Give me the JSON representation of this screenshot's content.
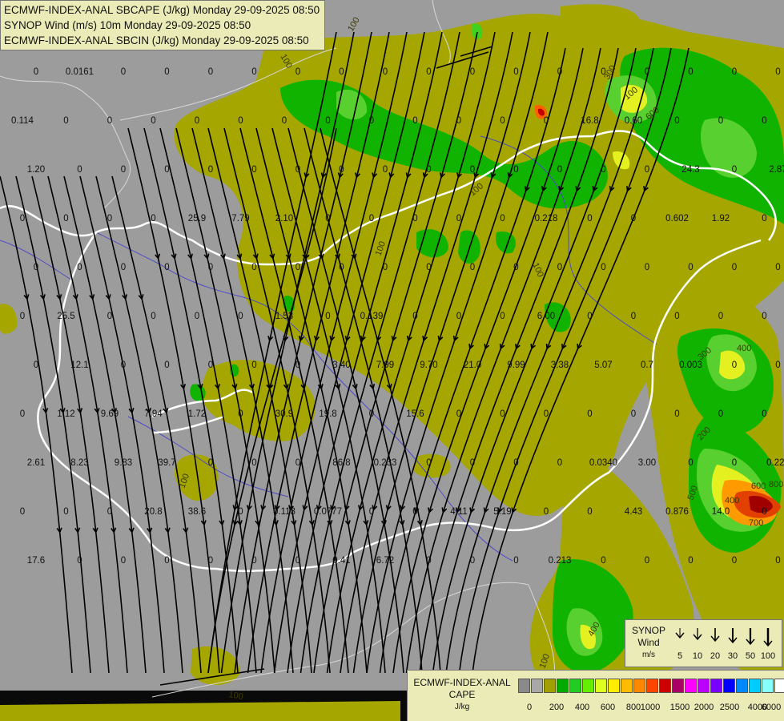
{
  "titles": [
    "ECMWF-INDEX-ANAL SBCAPE (J/kg) Monday 29-09-2025 08:50",
    "SYNOP Wind (m/s) 10m Monday 29-09-2025 08:50",
    "ECMWF-INDEX-ANAL SBCIN (J/kg) Monday 29-09-2025 08:50"
  ],
  "synop_legend": {
    "title_line1": "SYNOP",
    "title_line2": "Wind",
    "title_line3": "m/s",
    "values": [
      "5",
      "10",
      "20",
      "30",
      "50",
      "100"
    ]
  },
  "cape_legend": {
    "title_line1": "ECMWF-INDEX-ANAL",
    "title_line2": "CAPE",
    "title_line3": "J/kg",
    "swatch_colors": [
      "#8a8a8a",
      "#a8a8a8",
      "#a0a000",
      "#00aa00",
      "#22cc22",
      "#66ee00",
      "#ddff22",
      "#ffee00",
      "#ffbb00",
      "#ff8800",
      "#ff4400",
      "#cc0000",
      "#aa0066",
      "#ff00ff",
      "#bb00ff",
      "#7700ff",
      "#0000ff",
      "#0088ff",
      "#00ccff",
      "#88ffff",
      "#ffffff"
    ],
    "ticks": [
      "0",
      "200",
      "400",
      "600",
      "800",
      "1000",
      "1500",
      "2000",
      "2500",
      "4000",
      "6000"
    ]
  },
  "colors": {
    "background": "#9c9c9c",
    "cape_olive": "#a6a600",
    "cape_green": "#10b400",
    "cape_lightgreen": "#40d020",
    "cape_yellowgreen": "#b0f020",
    "cape_yellow": "#f0f000",
    "cape_orange": "#ff9000",
    "cape_red": "#c00000",
    "border_white": "#ffffff",
    "country_border": "#dddddd",
    "river": "#4b4bc8",
    "streamline": "#000000"
  },
  "cin_contour_labels": [
    "100",
    "100",
    "100",
    "100",
    "100",
    "100",
    "100",
    "100",
    "200",
    "300",
    "400",
    "400",
    "400",
    "500",
    "600",
    "700",
    "600",
    "800",
    "300",
    "100"
  ],
  "cin_numbers": [
    "0",
    "0.0161",
    "0",
    "0",
    "0",
    "0",
    "0",
    "0",
    "0",
    "0",
    "0",
    "0",
    "0",
    "0",
    "0",
    "0",
    "0",
    "0",
    "0.114",
    "0",
    "0",
    "0",
    "0",
    "0",
    "0",
    "0",
    "0",
    "0",
    "0",
    "0",
    "0",
    "16.8",
    "0.60",
    "0",
    "0",
    "0",
    "1.20",
    "0",
    "0",
    "0",
    "0",
    "0",
    "0",
    "0",
    "0",
    "0",
    "0",
    "0",
    "0",
    "0",
    "0",
    "24.3",
    "0",
    "2.87",
    "0",
    "0",
    "0",
    "0",
    "25.9",
    "7.79",
    "2.10",
    "0",
    "0",
    "0",
    "0",
    "0",
    "0.218",
    "0",
    "0",
    "0.602",
    "1.92",
    "0",
    "0",
    "0",
    "0",
    "0",
    "0",
    "0",
    "0",
    "0",
    "0",
    "0",
    "0",
    "0",
    "0",
    "0",
    "0",
    "0",
    "0",
    "0",
    "0",
    "25.5",
    "0",
    "0",
    "0",
    "0",
    "1.53",
    "0",
    "0.139",
    "0",
    "0",
    "0",
    "6.00",
    "0",
    "0",
    "0",
    "0",
    "0",
    "0",
    "12.1",
    "0",
    "0",
    "0",
    "0",
    "0",
    "3.40",
    "7.99",
    "9.70",
    "21.0",
    "9.99",
    "3.38",
    "5.07",
    "0.7",
    "0.003",
    "0",
    "0",
    "0",
    "1.12",
    "9.69",
    "7.94",
    "1.72",
    "0",
    "30.9",
    "19.8",
    "0",
    "15.6",
    "0",
    "0",
    "0",
    "0",
    "0",
    "0",
    "0",
    "0",
    "2.61",
    "8.23",
    "9.83",
    "39.7",
    "0",
    "0",
    "0",
    "86.8",
    "0.233",
    "0",
    "0",
    "0",
    "0",
    "0.0340",
    "3.00",
    "0",
    "0",
    "0.224",
    "0",
    "0",
    "0",
    "20.8",
    "38.6",
    "0",
    "0.113",
    "0.0777",
    "0",
    "0",
    "4.11",
    "5.19",
    "0",
    "0",
    "4.43",
    "0.876",
    "14.0",
    "0",
    "17.6",
    "0",
    "0",
    "0",
    "0",
    "0",
    "0",
    "0.41",
    "6.72",
    "0",
    "0",
    "0",
    "0.213",
    "0",
    "0",
    "0",
    "0",
    "0"
  ]
}
